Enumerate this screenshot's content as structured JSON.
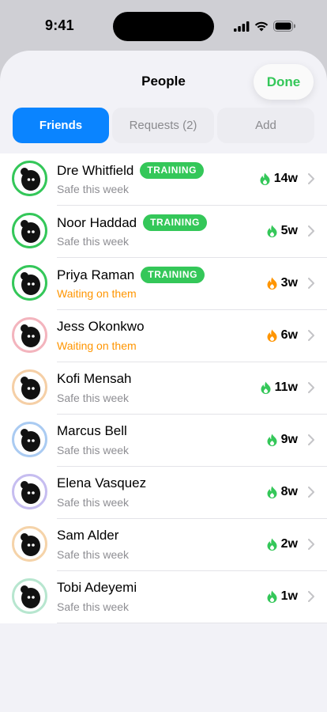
{
  "status_bar": {
    "time": "9:41"
  },
  "sheet": {
    "title": "People",
    "done_label": "Done",
    "tabs": [
      {
        "label": "Friends",
        "active": true
      },
      {
        "label": "Requests (2)",
        "active": false
      },
      {
        "label": "Add",
        "active": false
      }
    ]
  },
  "colors": {
    "accent_green": "#34c759",
    "accent_blue": "#0a84ff",
    "waiting_orange": "#ff9500"
  },
  "friends": [
    {
      "name": "Dre Whitfield",
      "badge": "TRAINING",
      "status": "Safe this week",
      "status_kind": "safe",
      "streak": "14w",
      "flame_color": "#34c759",
      "ring_color": "#34c759",
      "ring_style": "solid"
    },
    {
      "name": "Noor Haddad",
      "badge": "TRAINING",
      "status": "Safe this week",
      "status_kind": "safe",
      "streak": "5w",
      "flame_color": "#34c759",
      "ring_color": "#34c759",
      "ring_style": "solid"
    },
    {
      "name": "Priya Raman",
      "badge": "TRAINING",
      "status": "Waiting on them",
      "status_kind": "waiting",
      "streak": "3w",
      "flame_color": "#ff9500",
      "ring_color": "#34c759",
      "ring_style": "solid"
    },
    {
      "name": "Jess Okonkwo",
      "badge": "",
      "status": "Waiting on them",
      "status_kind": "waiting",
      "streak": "6w",
      "flame_color": "#ff9500",
      "ring_color": "#f3b4bd",
      "ring_style": "soft"
    },
    {
      "name": "Kofi Mensah",
      "badge": "",
      "status": "Safe this week",
      "status_kind": "safe",
      "streak": "11w",
      "flame_color": "#34c759",
      "ring_color": "#f5cfa6",
      "ring_style": "soft"
    },
    {
      "name": "Marcus Bell",
      "badge": "",
      "status": "Safe this week",
      "status_kind": "safe",
      "streak": "9w",
      "flame_color": "#34c759",
      "ring_color": "#aacbf2",
      "ring_style": "soft"
    },
    {
      "name": "Elena Vasquez",
      "badge": "",
      "status": "Safe this week",
      "status_kind": "safe",
      "streak": "8w",
      "flame_color": "#34c759",
      "ring_color": "#c6bdf0",
      "ring_style": "soft"
    },
    {
      "name": "Sam Alder",
      "badge": "",
      "status": "Safe this week",
      "status_kind": "safe",
      "streak": "2w",
      "flame_color": "#34c759",
      "ring_color": "#f5d3a9",
      "ring_style": "soft"
    },
    {
      "name": "Tobi Adeyemi",
      "badge": "",
      "status": "Safe this week",
      "status_kind": "safe",
      "streak": "1w",
      "flame_color": "#34c759",
      "ring_color": "#b7e6cf",
      "ring_style": "soft"
    }
  ],
  "icons": {
    "signal": "cellular-signal-icon",
    "wifi": "wifi-icon",
    "battery": "battery-icon",
    "avatar": "avatar-silhouette-icon",
    "flame": "flame-icon",
    "chevron": "chevron-right-icon"
  }
}
